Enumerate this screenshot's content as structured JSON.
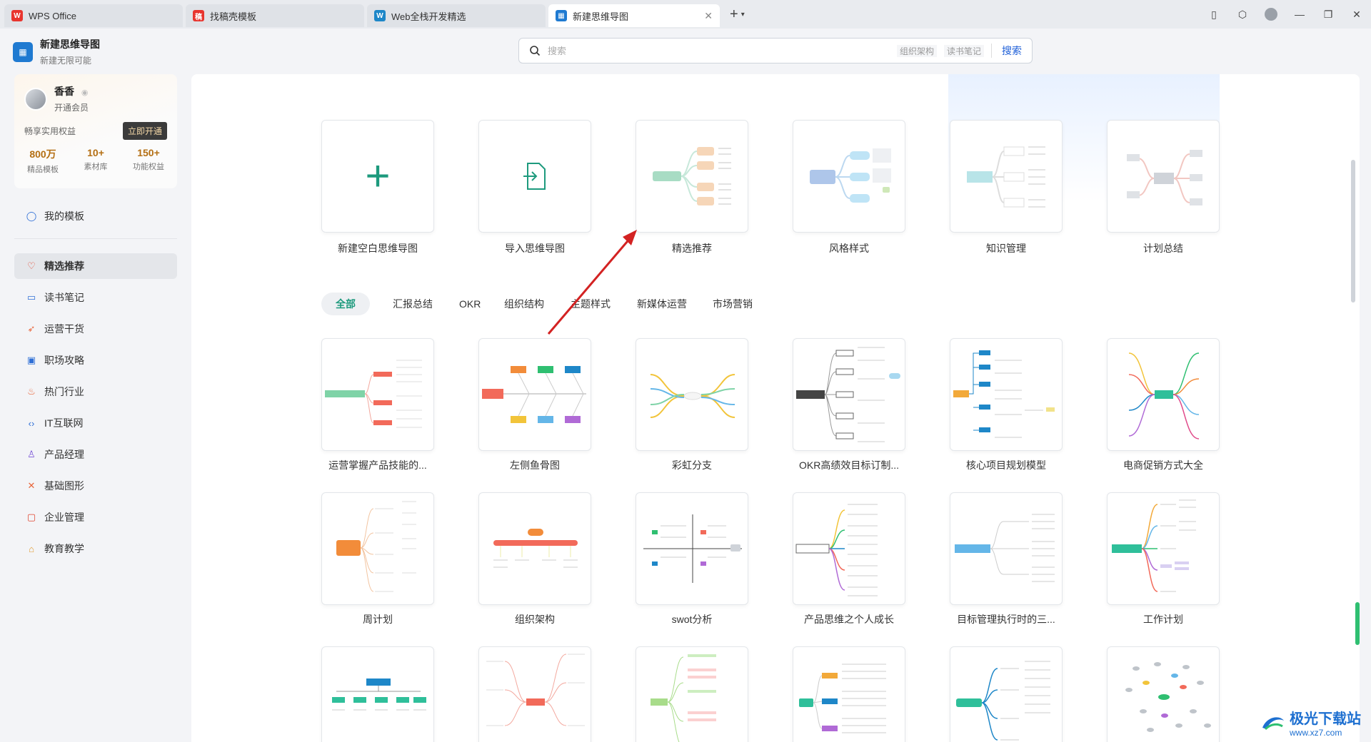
{
  "tabs": [
    {
      "label": "WPS Office",
      "icon": "wps-logo-icon",
      "color": "#e8352f"
    },
    {
      "label": "找稿壳模板",
      "icon": "template-app-icon",
      "color": "#e8352f"
    },
    {
      "label": "Web全栈开发精选",
      "icon": "doc-app-icon",
      "color": "#1e87c8"
    },
    {
      "label": "新建思维导图",
      "icon": "mindmap-app-icon",
      "color": "#1f7ad1"
    }
  ],
  "app": {
    "title": "新建思维导图",
    "subtitle": "新建无限可能"
  },
  "search": {
    "placeholder": "搜索",
    "hint1": "组织架构",
    "hint2": "读书笔记",
    "button": "搜索"
  },
  "member": {
    "name": "香香",
    "level": "开通会员",
    "perk_text": "畅享实用权益",
    "open_button": "立即开通",
    "stats": [
      {
        "value": "800万",
        "label": "精品模板"
      },
      {
        "value": "10+",
        "label": "素材库"
      },
      {
        "value": "150+",
        "label": "功能权益"
      }
    ]
  },
  "sidebar": {
    "my_templates": "我的模板",
    "items": [
      {
        "label": "精选推荐",
        "icon": "heart-icon",
        "color": "#e0452f"
      },
      {
        "label": "读书笔记",
        "icon": "book-icon",
        "color": "#2f6fd6"
      },
      {
        "label": "运营干货",
        "icon": "rocket-icon",
        "color": "#e8653a"
      },
      {
        "label": "职场攻略",
        "icon": "briefcase-icon",
        "color": "#2f6fd6"
      },
      {
        "label": "热门行业",
        "icon": "fire-icon",
        "color": "#e8653a"
      },
      {
        "label": "IT互联网",
        "icon": "code-icon",
        "color": "#2f6fd6"
      },
      {
        "label": "产品经理",
        "icon": "user-icon",
        "color": "#7a55d6"
      },
      {
        "label": "基础图形",
        "icon": "shapes-icon",
        "color": "#e8653a"
      },
      {
        "label": "企业管理",
        "icon": "calendar-icon",
        "color": "#e0452f"
      },
      {
        "label": "教育教学",
        "icon": "graduation-icon",
        "color": "#e09a2f"
      }
    ]
  },
  "top_cards": [
    "新建空白思维导图",
    "导入思维导图",
    "精选推荐",
    "风格样式",
    "知识管理",
    "计划总结"
  ],
  "filters": [
    "全部",
    "汇报总结",
    "OKR",
    "组织结构",
    "主题样式",
    "新媒体运营",
    "市场营销"
  ],
  "templates_row1": [
    "运营掌握产品技能的...",
    "左侧鱼骨图",
    "彩虹分支",
    "OKR高绩效目标订制...",
    "核心项目规划模型",
    "电商促销方式大全"
  ],
  "templates_row2": [
    "周计划",
    "组织架构",
    "swot分析",
    "产品思维之个人成长",
    "目标管理执行时的三...",
    "工作计划"
  ],
  "watermark": {
    "text": "极光下载站",
    "url": "www.xz7.com"
  },
  "colors": {
    "accent": "#1d9a7d",
    "primary": "#2060d8",
    "annotation_arrow": "#d32222"
  }
}
